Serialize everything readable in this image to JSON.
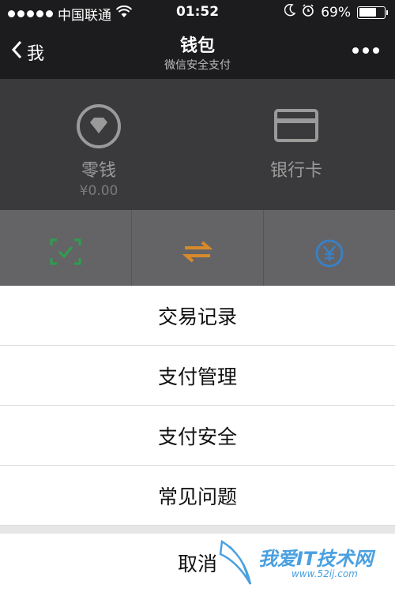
{
  "status_bar": {
    "carrier": "中国联通",
    "time": "01:52",
    "battery": "69%",
    "battery_level": 0.69
  },
  "nav": {
    "back_label": "我",
    "title": "钱包",
    "subtitle": "微信安全支付"
  },
  "wallet": {
    "change_label": "零钱",
    "change_amount": "¥0.00",
    "card_label": "银行卡"
  },
  "grid": {
    "icons": [
      "scan-pay-icon",
      "transfer-icon",
      "yuan-icon"
    ]
  },
  "action_sheet": {
    "items": [
      "交易记录",
      "支付管理",
      "支付安全",
      "常见问题"
    ],
    "cancel": "取消"
  },
  "watermark": {
    "text": "我爱IT技术网",
    "url": "www.52ij.com"
  },
  "colors": {
    "scan_green": "#2e9e4f",
    "transfer_orange": "#d88a2a",
    "yuan_blue": "#3b7fc4",
    "watermark_blue": "#4aa0e0"
  }
}
